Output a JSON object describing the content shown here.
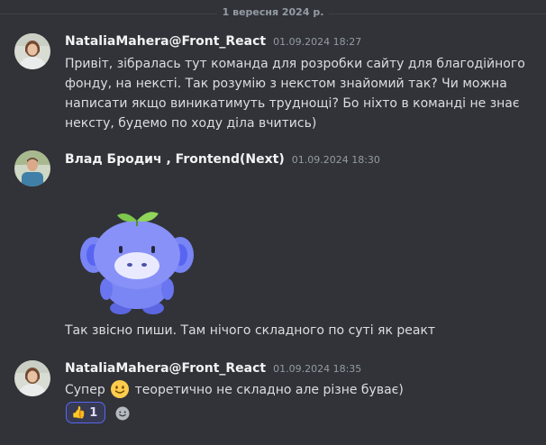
{
  "divider": {
    "date": "1 вересня 2024 р."
  },
  "messages": [
    {
      "author": "NataliaMahera@Front_React",
      "timestamp": "01.09.2024 18:27",
      "lines": [
        "Привіт, зібралась тут команда для розробки сайту для благодійного",
        "фонду, на нексті. Так розумію з некстом знайомий так? Чи можна",
        "написати якщо виникатимуть труднощі? Бо ніхто в команді не знає",
        "нексту, будемо по ходу діла вчитись)"
      ]
    },
    {
      "author": "Влад Бродич , Frontend(Next)",
      "timestamp": "01.09.2024 18:30",
      "text": "Так звісно пиши. Там нічого складного по суті як реакт"
    },
    {
      "author": "NataliaMahera@Front_React",
      "timestamp": "01.09.2024 18:35",
      "text_before": "Супер",
      "text_after": "теоретично не складно але різне буває)",
      "reaction": {
        "emoji": "👍",
        "count": "1"
      }
    }
  ],
  "icons": {
    "avatar_1": "user-avatar-icon",
    "avatar_2": "user-avatar-icon",
    "sticker": "wumpus-sticker",
    "inline_emoji": "slightly-smiling-face-emoji",
    "add_reaction": "add-reaction-icon"
  },
  "colors": {
    "background": "#313338",
    "text": "#dbdee1",
    "username": "#f2f3f5",
    "muted": "#949ba4",
    "reaction_border": "#5865f2"
  }
}
